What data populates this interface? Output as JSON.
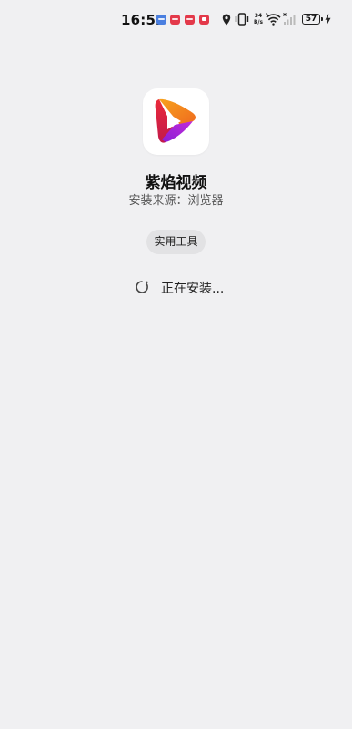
{
  "status_bar": {
    "time": "16:52",
    "net_speed_value": "34",
    "net_speed_unit": "B/s",
    "battery_level": "57"
  },
  "app": {
    "name": "紫焰视频",
    "install_source": "安装来源：浏览器",
    "category": "实用工具",
    "progress_text": "正在安装..."
  },
  "colors": {
    "background": "#f0f0f2",
    "chip_bg": "#e2e2e4",
    "icon_orange": "#f08a1c",
    "icon_red": "#e8273b",
    "icon_purple": "#b024d6"
  }
}
